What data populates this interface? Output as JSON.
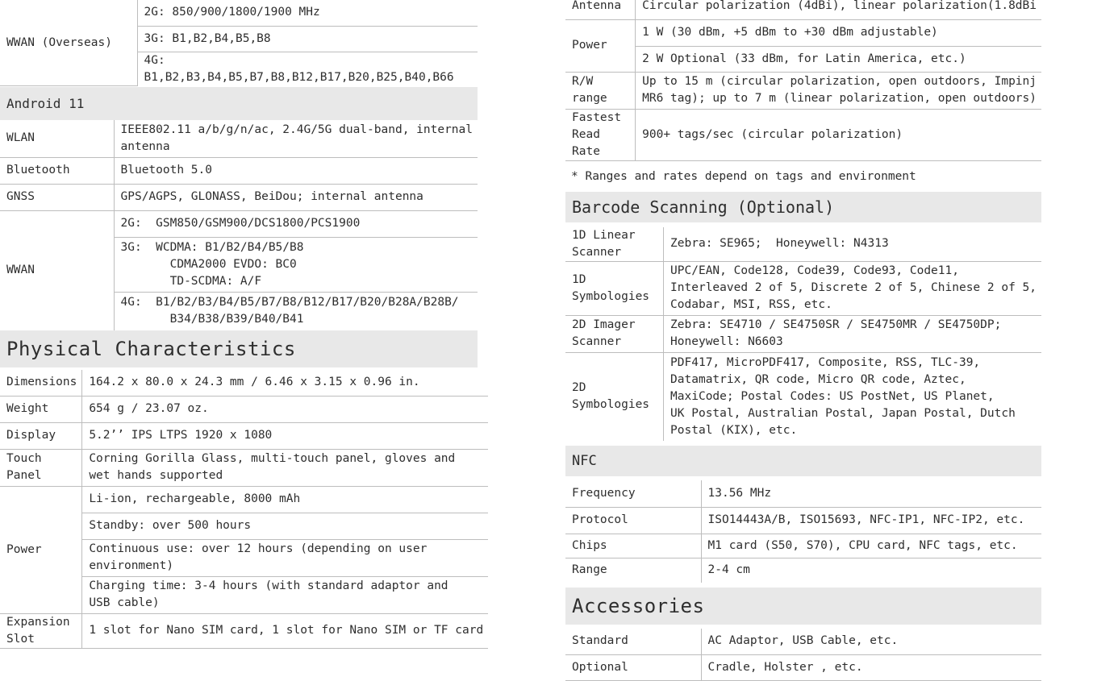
{
  "left": {
    "wwan_overseas": {
      "label": "WWAN (Overseas)",
      "rows": [
        "2G: 850/900/1800/1900 MHz",
        "3G: B1,B2,B4,B5,B8",
        "4G: B1,B2,B3,B4,B5,B7,B8,B12,B17,B20,B25,B40,B66"
      ]
    },
    "android_section": "Android 11",
    "wlan": {
      "label": "WLAN",
      "lines": [
        "IEEE802.11 a/b/g/n/ac, 2.4G/5G dual-band, internal",
        "antenna"
      ]
    },
    "bluetooth": {
      "label": "Bluetooth",
      "value": "Bluetooth 5.0"
    },
    "gnss": {
      "label": "GNSS",
      "value": "GPS/AGPS, GLONASS, BeiDou; internal antenna"
    },
    "wwan": {
      "label": "WWAN",
      "g2": "2G:  GSM850/GSM900/DCS1800/PCS1900",
      "g3": [
        "3G:  WCDMA: B1/B2/B4/B5/B8",
        "       CDMA2000 EVDO: BC0",
        "       TD-SCDMA: A/F"
      ],
      "g4": [
        "4G:  B1/B2/B3/B4/B5/B7/B8/B12/B17/B20/B28A/B28B/",
        "       B34/B38/B39/B40/B41"
      ]
    },
    "physical_title": "Physical Characteristics",
    "dimensions": {
      "label": "Dimensions",
      "value": "164.2 x 80.0 x 24.3 mm / 6.46 x 3.15 x 0.96 in."
    },
    "weight": {
      "label": "Weight",
      "value": "654 g / 23.07 oz."
    },
    "display": {
      "label": "Display",
      "value": "5.2’’ IPS LTPS 1920 x 1080"
    },
    "touch": {
      "label": "Touch Panel",
      "lines": [
        "Corning Gorilla Glass, multi-touch panel, gloves and",
        "wet hands supported"
      ]
    },
    "power": {
      "label": "Power",
      "r1": "Li-ion, rechargeable, 8000 mAh",
      "r2": "Standby: over 500 hours",
      "r3": [
        "Continuous use: over 12 hours (depending on user",
        "environment)"
      ],
      "r4": [
        "Charging time: 3-4 hours (with standard adaptor and",
        "USB cable)"
      ]
    },
    "expansion": {
      "label": "Expansion Slot",
      "value": "1 slot for Nano SIM card, 1 slot for Nano SIM or TF card"
    }
  },
  "right": {
    "antenna": {
      "label": "Antenna",
      "value": "Circular polarization (4dBi), linear polarization(1.8dBi"
    },
    "power": {
      "label": "Power",
      "r1": "1 W (30 dBm, +5 dBm to +30 dBm adjustable)",
      "r2": "2 W Optional (33 dBm, for Latin America, etc.)"
    },
    "rw_range": {
      "label": "R/W range",
      "lines": [
        "Up to 15 m (circular polarization, open outdoors, Impinj",
        "MR6 tag); up to 7 m (linear polarization, open outdoors)"
      ]
    },
    "fastest": {
      "label": "Fastest Read Rate",
      "value": "900+ tags/sec (circular polarization)"
    },
    "note": "* Ranges and rates depend on tags and environment",
    "barcode_title": "Barcode Scanning (Optional)",
    "linear": {
      "label": "1D Linear Scanner",
      "value": "Zebra: SE965;  Honeywell: N4313"
    },
    "sym1d": {
      "label": "1D Symbologies",
      "lines": [
        "UPC/EAN, Code128, Code39, Code93, Code11,",
        "Interleaved 2 of 5, Discrete 2 of 5, Chinese 2 of 5,",
        "Codabar, MSI, RSS, etc."
      ]
    },
    "imager": {
      "label": "2D Imager Scanner",
      "lines": [
        "Zebra: SE4710 / SE4750SR / SE4750MR / SE4750DP;",
        "Honeywell: N6603"
      ]
    },
    "sym2d": {
      "label": "2D Symbologies",
      "lines": [
        "PDF417, MicroPDF417, Composite, RSS, TLC-39,",
        "Datamatrix, QR code, Micro QR code, Aztec,",
        "MaxiCode; Postal Codes: US PostNet, US Planet,",
        "UK Postal, Australian Postal, Japan Postal, Dutch",
        "Postal (KIX), etc."
      ]
    },
    "nfc_title": "NFC",
    "frequency": {
      "label": "Frequency",
      "value": "13.56 MHz"
    },
    "protocol": {
      "label": "Protocol",
      "value": "ISO14443A/B, ISO15693, NFC-IP1, NFC-IP2, etc."
    },
    "chips": {
      "label": "Chips",
      "value": "M1 card (S50, S70), CPU card, NFC tags, etc."
    },
    "range": {
      "label": "Range",
      "value": "2-4 cm"
    },
    "accessories_title": "Accessories",
    "standard": {
      "label": "Standard",
      "value": "AC Adaptor, USB Cable, etc."
    },
    "optional": {
      "label": "Optional",
      "value": "Cradle, Holster , etc."
    }
  }
}
